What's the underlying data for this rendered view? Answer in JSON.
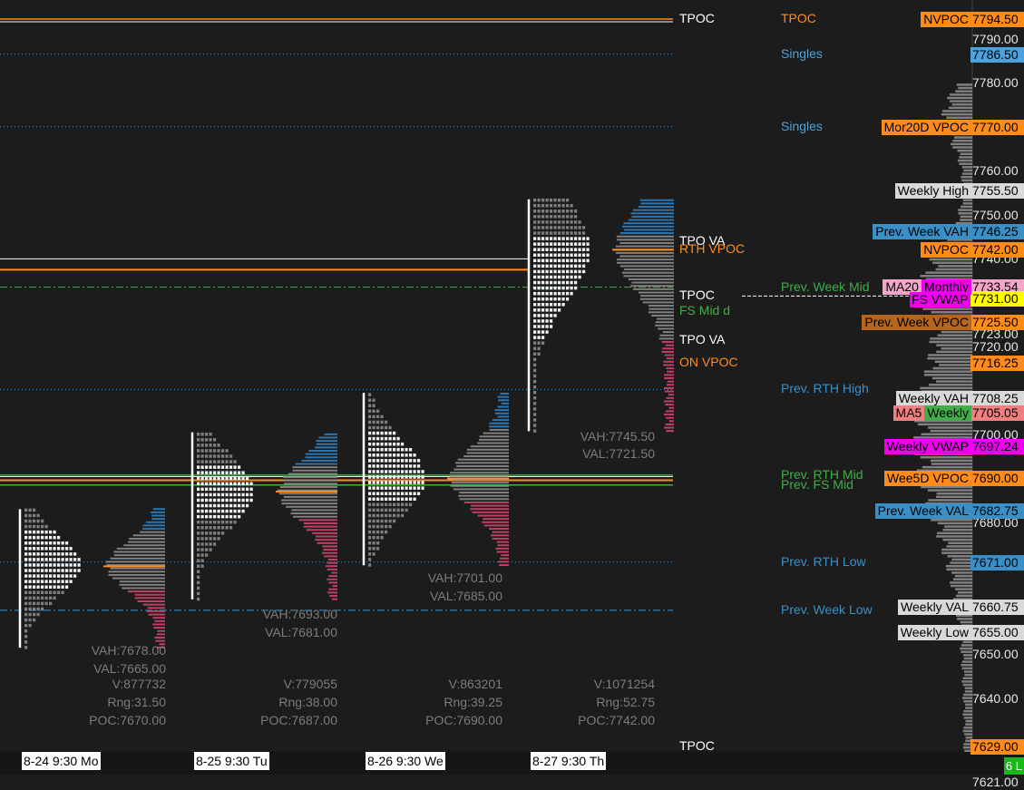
{
  "chart_data": {
    "type": "market-profile",
    "y_range": [
      7628,
      7798
    ],
    "axis_ticks": [
      7790.0,
      7780.0,
      7760.0,
      7750.0,
      7740.0,
      7723.0,
      7720.0,
      7700.0,
      7680.0,
      7650.0,
      7640.0,
      7621.0
    ],
    "axis_tags": [
      {
        "price": 7794.5,
        "text": "7794.50",
        "color": "#ff8c1a"
      },
      {
        "price": 7786.5,
        "text": "7786.50",
        "color": "#4aa3df"
      },
      {
        "price": 7770.0,
        "text": "7770.00",
        "color": "#ff8c1a"
      },
      {
        "price": 7755.5,
        "text": "7755.50",
        "color": "#d9d9d9"
      },
      {
        "price": 7746.25,
        "text": "7746.25",
        "color": "#3a8fc7"
      },
      {
        "price": 7742.0,
        "text": "7742.00",
        "color": "#ff8c1a"
      },
      {
        "price": 7733.54,
        "text": "7733.54",
        "color": "#f4a6c8"
      },
      {
        "price": 7731.0,
        "text": "7731.00",
        "color": "#ffff00"
      },
      {
        "price": 7725.5,
        "text": "7725.50",
        "color": "#ff8c1a"
      },
      {
        "price": 7716.25,
        "text": "7716.25",
        "color": "#ff8c1a"
      },
      {
        "price": 7708.25,
        "text": "7708.25",
        "color": "#d9d9d9"
      },
      {
        "price": 7705.05,
        "text": "7705.05",
        "color": "#f08080"
      },
      {
        "price": 7697.24,
        "text": "7697.24",
        "color": "#ee00ee"
      },
      {
        "price": 7690.0,
        "text": "7690.00",
        "color": "#ff8c1a"
      },
      {
        "price": 7682.75,
        "text": "7682.75",
        "color": "#3a8fc7"
      },
      {
        "price": 7671.0,
        "text": "7671.00",
        "color": "#3a8fc7"
      },
      {
        "price": 7660.75,
        "text": "7660.75",
        "color": "#d9d9d9"
      },
      {
        "price": 7655.0,
        "text": "7655.00",
        "color": "#d9d9d9"
      },
      {
        "price": 7629.0,
        "text": "7629.00",
        "color": "#ff8c1a"
      }
    ],
    "reference_levels": [
      {
        "price": 7794.5,
        "name": "TPOC",
        "color": "#ff8c1a",
        "style": "solid"
      },
      {
        "price": 7786.5,
        "name": "Singles",
        "color": "#4aa3df",
        "style": "dotted"
      },
      {
        "price": 7770.0,
        "name": "Singles",
        "color": "#4aa3df",
        "style": "dotted"
      },
      {
        "price": 7733.5,
        "name": "Prev. Week Mid",
        "color": "#3fae49",
        "style": "dashdot"
      },
      {
        "price": 7710.25,
        "name": "Prev. RTH High",
        "color": "#3a8fc7",
        "style": "dotted"
      },
      {
        "price": 7690.75,
        "name": "Prev. RTH Mid",
        "color": "#3fae49",
        "style": "solid"
      },
      {
        "price": 7688.5,
        "name": "Prev. FS Mid",
        "color": "#3fae49",
        "style": "solid"
      },
      {
        "price": 7671.0,
        "name": "Prev. RTH Low",
        "color": "#3a8fc7",
        "style": "dotted"
      },
      {
        "price": 7660.0,
        "name": "Prev. Week Low",
        "color": "#3a8fc7",
        "style": "dashdot"
      }
    ],
    "right_labels": [
      {
        "price": 7794.5,
        "text": "NVPOC",
        "bg": "#ff8c1a",
        "fg": "#000000"
      },
      {
        "price": 7770.0,
        "text": "Mor20D VPOC",
        "bg": "#ff8c1a",
        "fg": "#000000"
      },
      {
        "price": 7755.5,
        "text": "Weekly High",
        "bg": "#d9d9d9",
        "fg": "#000000"
      },
      {
        "price": 7746.25,
        "text": "Prev. Week VAH",
        "bg": "#3a8fc7",
        "fg": "#000000"
      },
      {
        "price": 7742.0,
        "text": "NVPOC",
        "bg": "#ff8c1a",
        "fg": "#000000"
      },
      {
        "price": 7733.54,
        "text": "Monthly",
        "bg": "#ee00ee",
        "fg": "#000000"
      },
      {
        "price": 7733.54,
        "text": "MA20",
        "bg": "#f4a6c8",
        "fg": "#000000"
      },
      {
        "price": 7725.5,
        "text": "Prev. Week VPOC",
        "bg": "#b5651d",
        "fg": "#000000"
      },
      {
        "price": 7708.25,
        "text": "Weekly VAH",
        "bg": "#d9d9d9",
        "fg": "#000000"
      },
      {
        "price": 7705.05,
        "text": "Weekly",
        "bg": "#3fae49",
        "fg": "#000000"
      },
      {
        "price": 7705.05,
        "text": "MA5",
        "bg": "#f08080",
        "fg": "#000000"
      },
      {
        "price": 7697.24,
        "text": "Weekly VWAP",
        "bg": "#ee00ee",
        "fg": "#000000"
      },
      {
        "price": 7690.0,
        "text": "Wee5D VPOC",
        "bg": "#ff8c1a",
        "fg": "#000000"
      },
      {
        "price": 7682.75,
        "text": "Prev. Week VAL",
        "bg": "#3a8fc7",
        "fg": "#000000"
      },
      {
        "price": 7660.75,
        "text": "Weekly VAL",
        "bg": "#d9d9d9",
        "fg": "#000000"
      },
      {
        "price": 7655.0,
        "text": "Weekly Low",
        "bg": "#d9d9d9",
        "fg": "#000000"
      }
    ],
    "profile_labels": [
      {
        "price": 7794.5,
        "text": "TPOC",
        "color": "#ffffff"
      },
      {
        "price": 7744.0,
        "text": "TPO VA",
        "color": "#ffffff"
      },
      {
        "price": 7742.0,
        "text": "RTH VPOC",
        "color": "#ff8c1a"
      },
      {
        "price": 7731.5,
        "text": "TPOC",
        "color": "#ffffff"
      },
      {
        "price": 7728.0,
        "text": "FS Mid d",
        "color": "#3fae49"
      },
      {
        "price": 7721.5,
        "text": "TPO VA",
        "color": "#ffffff"
      },
      {
        "price": 7716.25,
        "text": "ON VPOC",
        "color": "#ff8c1a"
      },
      {
        "price": 7629.0,
        "text": "TPOC",
        "color": "#ffffff"
      }
    ],
    "sessions": [
      {
        "date": "8-24  9:30 Mo",
        "high": 7683.0,
        "low": 7651.5,
        "poc": 7670.0,
        "vah": 7678.0,
        "val": 7665.0,
        "volume": "V:877732",
        "range": "Rng:31.50",
        "vah_text": "VAH:7678.00",
        "val_text": "VAL:7665.00",
        "poc_text": "POC:7670.00"
      },
      {
        "date": "8-25  9:30 Tu",
        "high": 7700.5,
        "low": 7662.5,
        "poc": 7687.0,
        "vah": 7693.0,
        "val": 7681.0,
        "volume": "V:779055",
        "range": "Rng:38.00",
        "vah_text": "VAH:7693.00",
        "val_text": "VAL:7681.00",
        "poc_text": "POC:7687.00"
      },
      {
        "date": "8-26  9:30 We",
        "high": 7709.5,
        "low": 7670.25,
        "poc": 7690.0,
        "vah": 7701.0,
        "val": 7685.0,
        "volume": "V:863201",
        "range": "Rng:39.25",
        "vah_text": "VAH:7701.00",
        "val_text": "VAL:7685.00",
        "poc_text": "POC:7690.00"
      },
      {
        "date": "8-27  9:30 Th",
        "high": 7753.5,
        "low": 7700.75,
        "poc": 7742.0,
        "vah": 7745.5,
        "val": 7721.5,
        "volume": "V:1071254",
        "range": "Rng:52.75",
        "vah_text": "VAH:7745.50",
        "val_text": "VAL:7721.50",
        "poc_text": "POC:7742.00"
      }
    ],
    "inline_label": "FS VWAP",
    "status_badge": "6 L"
  }
}
